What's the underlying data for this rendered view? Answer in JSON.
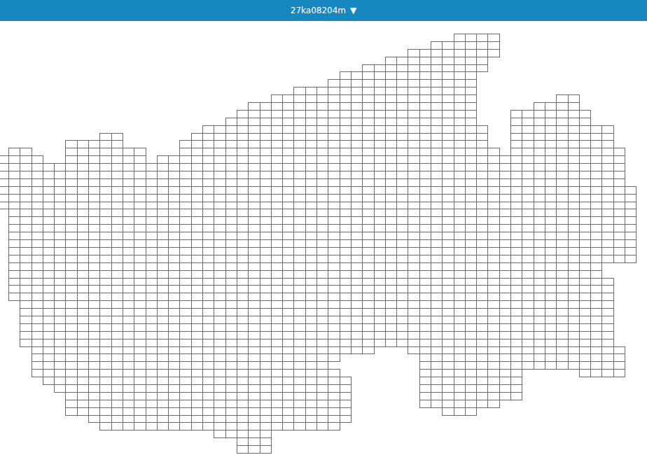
{
  "header": {
    "title": "27ka08204m",
    "toggle": "▼"
  },
  "grid": {
    "rows": [
      [
        [
          40,
          43
        ]
      ],
      [
        [
          38,
          43
        ]
      ],
      [
        [
          36,
          43
        ]
      ],
      [
        [
          34,
          42
        ]
      ],
      [
        [
          32,
          42
        ]
      ],
      [
        [
          30,
          41
        ]
      ],
      [
        [
          29,
          41
        ]
      ],
      [
        [
          26,
          41
        ]
      ],
      [
        [
          24,
          41
        ],
        [
          49,
          50
        ]
      ],
      [
        [
          22,
          41
        ],
        [
          47,
          50
        ]
      ],
      [
        [
          21,
          41
        ],
        [
          45,
          51
        ]
      ],
      [
        [
          20,
          41
        ],
        [
          45,
          51
        ]
      ],
      [
        [
          18,
          42
        ],
        [
          45,
          53
        ]
      ],
      [
        [
          9,
          10
        ],
        [
          17,
          42
        ],
        [
          45,
          53
        ]
      ],
      [
        [
          6,
          10
        ],
        [
          16,
          42
        ],
        [
          45,
          53
        ]
      ],
      [
        [
          1,
          2
        ],
        [
          6,
          12
        ],
        [
          16,
          43
        ],
        [
          45,
          54
        ]
      ],
      [
        [
          0,
          3
        ],
        [
          6,
          12
        ],
        [
          14,
          54
        ]
      ],
      [
        [
          0,
          54
        ]
      ],
      [
        [
          0,
          54
        ]
      ],
      [
        [
          0,
          54
        ]
      ],
      [
        [
          0,
          55
        ]
      ],
      [
        [
          0,
          55
        ]
      ],
      [
        [
          0,
          55
        ]
      ],
      [
        [
          1,
          55
        ]
      ],
      [
        [
          1,
          55
        ]
      ],
      [
        [
          1,
          55
        ]
      ],
      [
        [
          1,
          55
        ]
      ],
      [
        [
          1,
          55
        ]
      ],
      [
        [
          1,
          55
        ]
      ],
      [
        [
          1,
          55
        ]
      ],
      [
        [
          1,
          52
        ]
      ],
      [
        [
          1,
          52
        ]
      ],
      [
        [
          1,
          53
        ]
      ],
      [
        [
          1,
          53
        ]
      ],
      [
        [
          1,
          53
        ]
      ],
      [
        [
          2,
          53
        ]
      ],
      [
        [
          2,
          53
        ]
      ],
      [
        [
          2,
          53
        ]
      ],
      [
        [
          2,
          53
        ]
      ],
      [
        [
          2,
          53
        ]
      ],
      [
        [
          2,
          53
        ]
      ],
      [
        [
          3,
          32
        ],
        [
          36,
          54
        ]
      ],
      [
        [
          3,
          29
        ],
        [
          37,
          54
        ]
      ],
      [
        [
          3,
          28
        ],
        [
          37,
          54
        ]
      ],
      [
        [
          3,
          29
        ],
        [
          37,
          45
        ],
        [
          51,
          54
        ]
      ],
      [
        [
          4,
          30
        ],
        [
          37,
          45
        ]
      ],
      [
        [
          5,
          30
        ],
        [
          37,
          45
        ]
      ],
      [
        [
          6,
          30
        ],
        [
          37,
          45
        ]
      ],
      [
        [
          6,
          30
        ],
        [
          37,
          43
        ]
      ],
      [
        [
          6,
          30
        ],
        [
          39,
          41
        ]
      ],
      [
        [
          8,
          30
        ]
      ],
      [
        [
          9,
          29
        ]
      ],
      [
        [
          19,
          23
        ]
      ],
      [
        [
          21,
          23
        ]
      ],
      [
        [
          21,
          23
        ]
      ]
    ]
  }
}
